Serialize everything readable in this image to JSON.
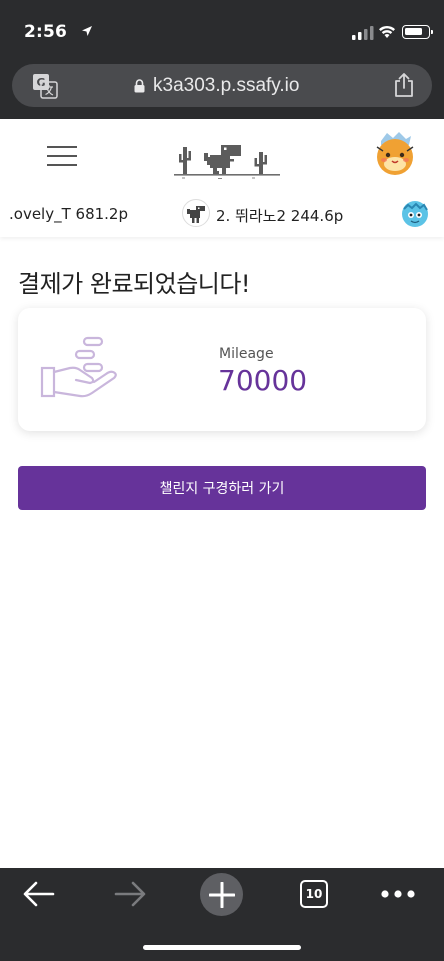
{
  "status_bar": {
    "time": "2:56"
  },
  "browser": {
    "url": "k3a303.p.ssafy.io",
    "tab_count": "10"
  },
  "ranking_ticker": [
    {
      "text": ".ovely_T 681.2p"
    },
    {
      "text": "2. 뛰라노2 244.6p"
    }
  ],
  "main": {
    "title": "결제가 완료되었습니다!",
    "mileage_label": "Mileage",
    "mileage_value": "70000",
    "cta_label": "챌린지 구경하러 가기"
  },
  "colors": {
    "accent": "#66339a",
    "chrome": "#2b2c2e",
    "icon_lilac": "#c9b6dc"
  },
  "icons": {
    "translate": "translate-icon",
    "lock": "lock-icon",
    "share": "share-icon",
    "menu": "hamburger-menu-icon",
    "logo": "dino-logo",
    "mileage": "coins-hand-icon",
    "back": "back-arrow-icon",
    "forward": "forward-arrow-icon",
    "new_tab": "plus-icon",
    "more": "more-dots-icon"
  }
}
